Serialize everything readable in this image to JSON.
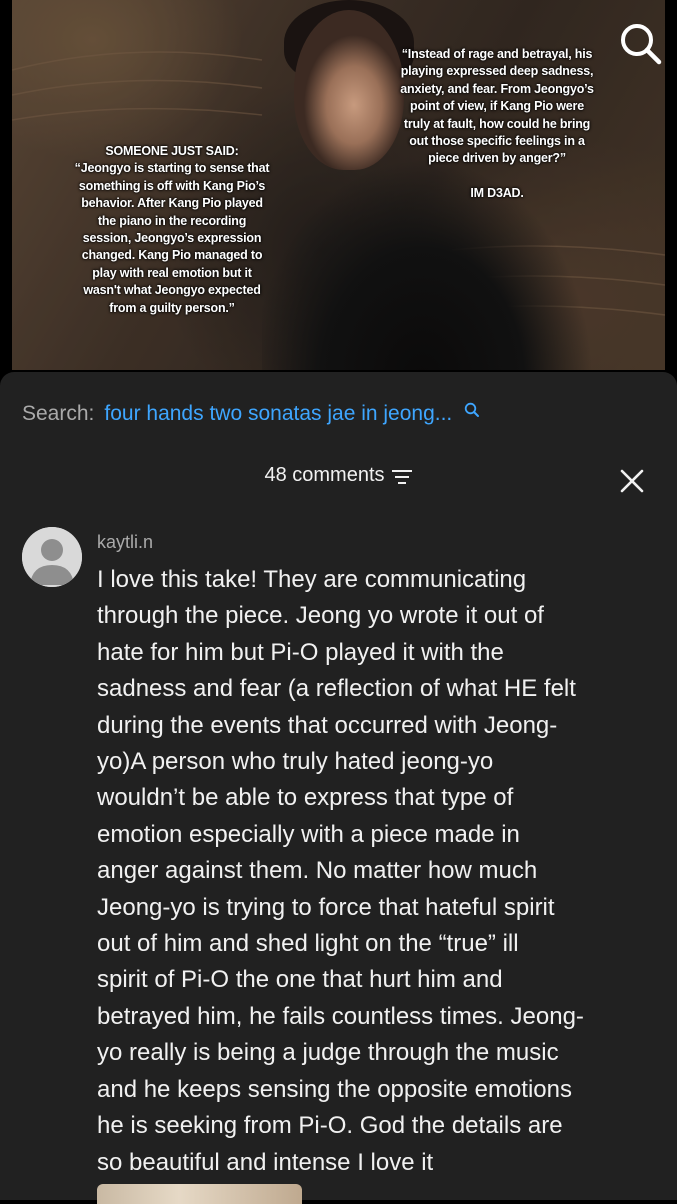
{
  "video": {
    "overlay_left": [
      "SOMEONE JUST SAID:",
      "“Jeongyo is starting to sense that",
      "something is off with Kang Pio’s",
      "behavior. After Kang Pio played",
      "the piano in the recording",
      "session, Jeongyo’s expression",
      "changed. Kang Pio managed to",
      "play with real emotion but it",
      "wasn't what Jeongyo expected",
      "from a guilty person.”"
    ],
    "overlay_right": [
      "“Instead of rage and betrayal, his",
      "playing expressed deep sadness,",
      "anxiety, and fear. From Jeongyo’s",
      "point of view, if Kang Pio were",
      "truly at fault, how could he bring",
      "out those specific feelings in a",
      "piece driven by anger?”"
    ],
    "signature": "IM D3AD."
  },
  "search": {
    "prefix": "Search:",
    "query": "four hands two sonatas jae in jeong..."
  },
  "comments": {
    "count_label": "48 comments"
  },
  "comment": {
    "author": "kaytli.n",
    "lines": [
      "I love this take! They are communicating",
      "through the piece. Jeong yo wrote it out of",
      "hate for him but Pi-O played it with the",
      "sadness and fear (a reflection of what HE felt",
      "during the events that occurred with Jeong-",
      "yo)A person who truly hated jeong-yo",
      "wouldn’t be able to express that type of",
      "emotion especially with a piece made in",
      "anger against them. No matter how much",
      "Jeong-yo is trying to force that hateful spirit",
      "out of him and shed light on the “true” ill",
      "spirit of Pi-O the one that hurt him and",
      "betrayed him, he fails countless times. Jeong-",
      "yo really is being a judge through the music",
      "and he keeps sensing the opposite emotions",
      "he is seeking from Pi-O. God the details are",
      "so beautiful and intense I love it"
    ]
  },
  "colors": {
    "panel_bg": "#212121",
    "link_blue": "#3ea6ff",
    "secondary_text": "#aaaaaa",
    "primary_text": "#f1f1f1"
  },
  "icons": [
    "search-icon",
    "sort-icon",
    "close-icon",
    "avatar-placeholder-icon"
  ]
}
